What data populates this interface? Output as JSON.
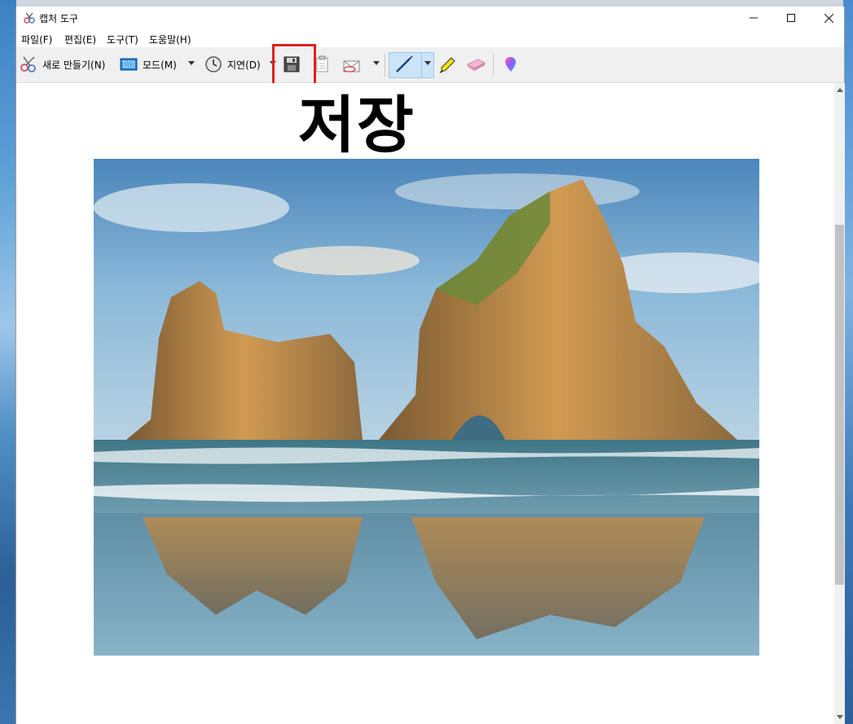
{
  "window": {
    "title": "캡처 도구"
  },
  "menu": {
    "file": "파일(F)",
    "edit": "편집(E)",
    "tools": "도구(T)",
    "help": "도움말(H)"
  },
  "toolbar": {
    "new_label": "새로 만들기(N)",
    "mode_label": "모드(M)",
    "delay_label": "지연(D)"
  },
  "content": {
    "caption": "저장"
  },
  "icons": {
    "app": "scissors-icon",
    "minimize": "minimize-icon",
    "maximize": "maximize-icon",
    "close": "close-icon",
    "new": "scissors-icon",
    "mode": "mode-rect-icon",
    "delay": "clock-icon",
    "save": "save-icon",
    "copy": "copy-icon",
    "send": "envelope-icon",
    "pen": "pen-icon",
    "highlighter": "highlighter-icon",
    "eraser": "eraser-icon",
    "paint3d": "paint3d-icon"
  },
  "colors": {
    "highlight": "#e02020",
    "active_tool": "#cce4f7",
    "window_bg": "#ffffff",
    "toolbar_bg": "#f0f0f0"
  }
}
